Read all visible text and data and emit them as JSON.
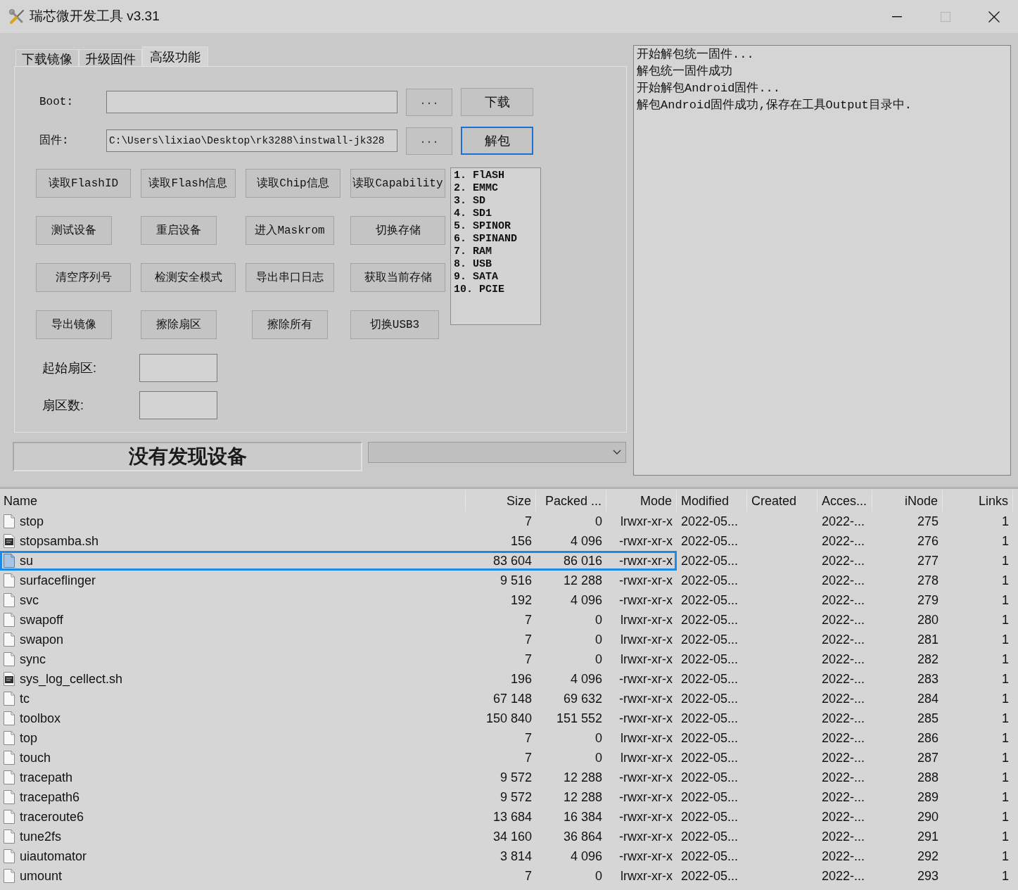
{
  "window": {
    "title": "瑞芯微开发工具 v3.31",
    "controls": [
      {
        "kind": "minimize",
        "disabled": false
      },
      {
        "kind": "maximize",
        "disabled": true
      },
      {
        "kind": "close",
        "disabled": false
      }
    ]
  },
  "tabs": [
    {
      "label": "下载镜像",
      "selected": false
    },
    {
      "label": "升级固件",
      "selected": false
    },
    {
      "label": "高级功能",
      "selected": true
    }
  ],
  "path_rows": [
    {
      "label": "Boot:",
      "browse_label": "...",
      "action_label": "下载",
      "action_focused": false
    },
    {
      "label": "固件:",
      "value": "C:\\Users\\lixiao\\Desktop\\rk3288\\instwall-jk328",
      "browse_label": "...",
      "action_label": "解包",
      "action_focused": true
    }
  ],
  "actions": [
    "读取FlashID",
    "读取Flash信息",
    "读取Chip信息",
    "读取Capability",
    "测试设备",
    "重启设备",
    "进入Maskrom",
    "切换存储",
    "清空序列号",
    "检测安全模式",
    "导出串口日志",
    "获取当前存储",
    "导出镜像",
    "擦除扇区",
    "擦除所有",
    "切换USB3"
  ],
  "storage_list": [
    {
      "label": "1. FlASH",
      "selected": false
    },
    {
      "label": "2. EMMC",
      "selected": false
    },
    {
      "label": "3. SD",
      "selected": false
    },
    {
      "label": "4. SD1",
      "selected": false
    },
    {
      "label": "5. SPINOR",
      "selected": false
    },
    {
      "label": "6. SPINAND",
      "selected": false
    },
    {
      "label": "7. RAM",
      "selected": false
    },
    {
      "label": "8. USB",
      "selected": false
    },
    {
      "label": "9. SATA",
      "selected": false
    },
    {
      "label": "10. PCIE",
      "selected": false
    }
  ],
  "sector_fields": [
    {
      "label": "起始扇区:"
    },
    {
      "label": "扇区数:"
    }
  ],
  "status_bar": {
    "message": "没有发现设备"
  },
  "log": [
    "开始解包统一固件...",
    "解包统一固件成功",
    "开始解包Android固件...",
    "解包Android固件成功,保存在工具Output目录中."
  ],
  "file_list": {
    "columns": [
      "Name",
      "Size",
      "Packed ...",
      "Mode",
      "Modified",
      "Created",
      "Acces...",
      "iNode",
      "Links"
    ],
    "rows": [
      {
        "kind": "file",
        "selected": false,
        "name": "stop",
        "size": "7",
        "packed": "0",
        "mode": "lrwxr-xr-x",
        "modified": "2022-05...",
        "accessed": "2022-...",
        "inode": "275",
        "links": "1"
      },
      {
        "kind": "script",
        "selected": false,
        "name": "stopsamba.sh",
        "size": "156",
        "packed": "4 096",
        "mode": "-rwxr-xr-x",
        "modified": "2022-05...",
        "accessed": "2022-...",
        "inode": "276",
        "links": "1"
      },
      {
        "kind": "file",
        "selected": true,
        "name": "su",
        "size": "83 604",
        "packed": "86 016",
        "mode": "-rwxr-xr-x",
        "modified": "2022-05...",
        "accessed": "2022-...",
        "inode": "277",
        "links": "1"
      },
      {
        "kind": "file",
        "selected": false,
        "name": "surfaceflinger",
        "size": "9 516",
        "packed": "12 288",
        "mode": "-rwxr-xr-x",
        "modified": "2022-05...",
        "accessed": "2022-...",
        "inode": "278",
        "links": "1"
      },
      {
        "kind": "file",
        "selected": false,
        "name": "svc",
        "size": "192",
        "packed": "4 096",
        "mode": "-rwxr-xr-x",
        "modified": "2022-05...",
        "accessed": "2022-...",
        "inode": "279",
        "links": "1"
      },
      {
        "kind": "file",
        "selected": false,
        "name": "swapoff",
        "size": "7",
        "packed": "0",
        "mode": "lrwxr-xr-x",
        "modified": "2022-05...",
        "accessed": "2022-...",
        "inode": "280",
        "links": "1"
      },
      {
        "kind": "file",
        "selected": false,
        "name": "swapon",
        "size": "7",
        "packed": "0",
        "mode": "lrwxr-xr-x",
        "modified": "2022-05...",
        "accessed": "2022-...",
        "inode": "281",
        "links": "1"
      },
      {
        "kind": "file",
        "selected": false,
        "name": "sync",
        "size": "7",
        "packed": "0",
        "mode": "lrwxr-xr-x",
        "modified": "2022-05...",
        "accessed": "2022-...",
        "inode": "282",
        "links": "1"
      },
      {
        "kind": "script",
        "selected": false,
        "name": "sys_log_cellect.sh",
        "size": "196",
        "packed": "4 096",
        "mode": "-rwxr-xr-x",
        "modified": "2022-05...",
        "accessed": "2022-...",
        "inode": "283",
        "links": "1"
      },
      {
        "kind": "file",
        "selected": false,
        "name": "tc",
        "size": "67 148",
        "packed": "69 632",
        "mode": "-rwxr-xr-x",
        "modified": "2022-05...",
        "accessed": "2022-...",
        "inode": "284",
        "links": "1"
      },
      {
        "kind": "file",
        "selected": false,
        "name": "toolbox",
        "size": "150 840",
        "packed": "151 552",
        "mode": "-rwxr-xr-x",
        "modified": "2022-05...",
        "accessed": "2022-...",
        "inode": "285",
        "links": "1"
      },
      {
        "kind": "file",
        "selected": false,
        "name": "top",
        "size": "7",
        "packed": "0",
        "mode": "lrwxr-xr-x",
        "modified": "2022-05...",
        "accessed": "2022-...",
        "inode": "286",
        "links": "1"
      },
      {
        "kind": "file",
        "selected": false,
        "name": "touch",
        "size": "7",
        "packed": "0",
        "mode": "lrwxr-xr-x",
        "modified": "2022-05...",
        "accessed": "2022-...",
        "inode": "287",
        "links": "1"
      },
      {
        "kind": "file",
        "selected": false,
        "name": "tracepath",
        "size": "9 572",
        "packed": "12 288",
        "mode": "-rwxr-xr-x",
        "modified": "2022-05...",
        "accessed": "2022-...",
        "inode": "288",
        "links": "1"
      },
      {
        "kind": "file",
        "selected": false,
        "name": "tracepath6",
        "size": "9 572",
        "packed": "12 288",
        "mode": "-rwxr-xr-x",
        "modified": "2022-05...",
        "accessed": "2022-...",
        "inode": "289",
        "links": "1"
      },
      {
        "kind": "file",
        "selected": false,
        "name": "traceroute6",
        "size": "13 684",
        "packed": "16 384",
        "mode": "-rwxr-xr-x",
        "modified": "2022-05...",
        "accessed": "2022-...",
        "inode": "290",
        "links": "1"
      },
      {
        "kind": "file",
        "selected": false,
        "name": "tune2fs",
        "size": "34 160",
        "packed": "36 864",
        "mode": "-rwxr-xr-x",
        "modified": "2022-05...",
        "accessed": "2022-...",
        "inode": "291",
        "links": "1"
      },
      {
        "kind": "file",
        "selected": false,
        "name": "uiautomator",
        "size": "3 814",
        "packed": "4 096",
        "mode": "-rwxr-xr-x",
        "modified": "2022-05...",
        "accessed": "2022-...",
        "inode": "292",
        "links": "1"
      },
      {
        "kind": "file",
        "selected": false,
        "name": "umount",
        "size": "7",
        "packed": "0",
        "mode": "lrwxr-xr-x",
        "modified": "2022-05...",
        "accessed": "2022-...",
        "inode": "293",
        "links": "1"
      }
    ]
  }
}
